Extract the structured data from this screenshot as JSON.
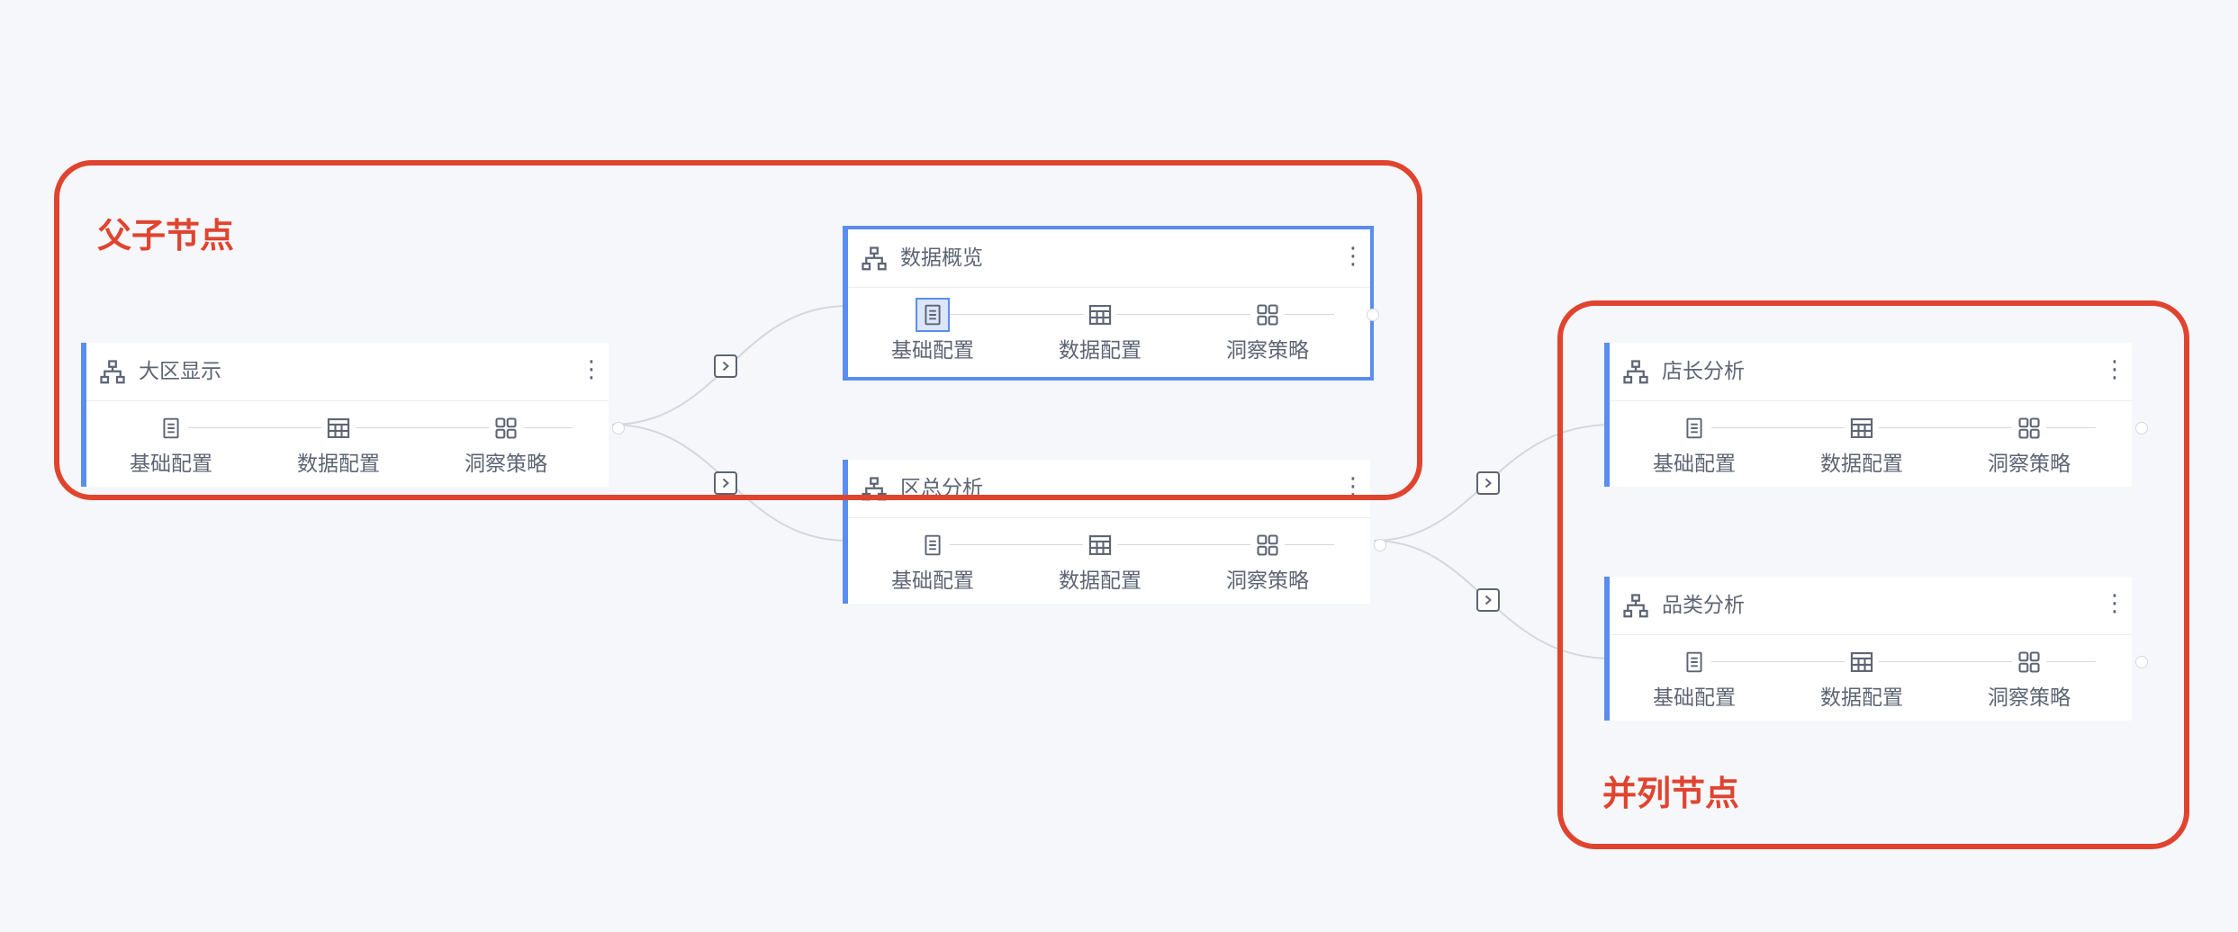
{
  "nodes": [
    {
      "id": "daqu",
      "title": "大区显示",
      "selected": false
    },
    {
      "id": "shuju",
      "title": "数据概览",
      "selected": true
    },
    {
      "id": "quzong",
      "title": "区总分析",
      "selected": false
    },
    {
      "id": "dianzhang",
      "title": "店长分析",
      "selected": false
    },
    {
      "id": "pinlei",
      "title": "品类分析",
      "selected": false
    }
  ],
  "steps": {
    "basic": "基础配置",
    "data": "数据配置",
    "insight": "洞察策略"
  },
  "annotations": {
    "parent_child": "父子节点",
    "parallel": "并列节点"
  },
  "icons": {
    "node": "org-tree-icon",
    "menu": "more-vertical-icon",
    "basic": "document-icon",
    "data": "table-grid-icon",
    "insight": "four-squares-icon",
    "expand": "chevron-right-square-icon"
  },
  "colors": {
    "accent": "#5b8def",
    "annotation": "#e0442f",
    "text": "#5d6473",
    "background": "#f5f7fa"
  }
}
